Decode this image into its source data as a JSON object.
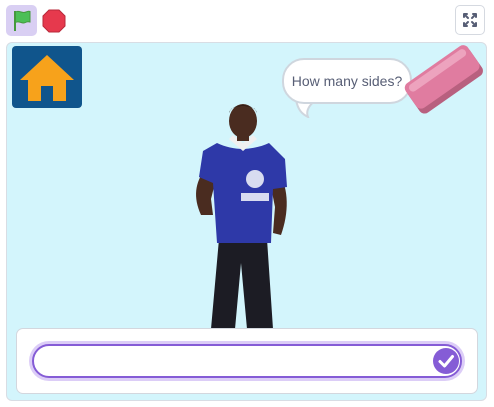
{
  "toolbar": {
    "green_flag_icon": "green-flag-icon",
    "stop_icon": "stop-icon",
    "fullscreen_icon": "fullscreen-icon"
  },
  "stage": {
    "home_icon": "home-icon",
    "speech_bubble": {
      "text": "How many sides?"
    },
    "eraser_icon": "eraser-icon",
    "sprite": "person-sprite"
  },
  "ask_prompt": {
    "answer_value": "",
    "submit_icon": "checkmark-icon"
  },
  "colors": {
    "accent": "#855cd6",
    "stage_bg": "#d3f5fc",
    "home_bg": "#10558c",
    "home_fg": "#f7a21b",
    "flag": "#4cbf56",
    "stop": "#e6394d",
    "eraser": "#e07ca0"
  }
}
